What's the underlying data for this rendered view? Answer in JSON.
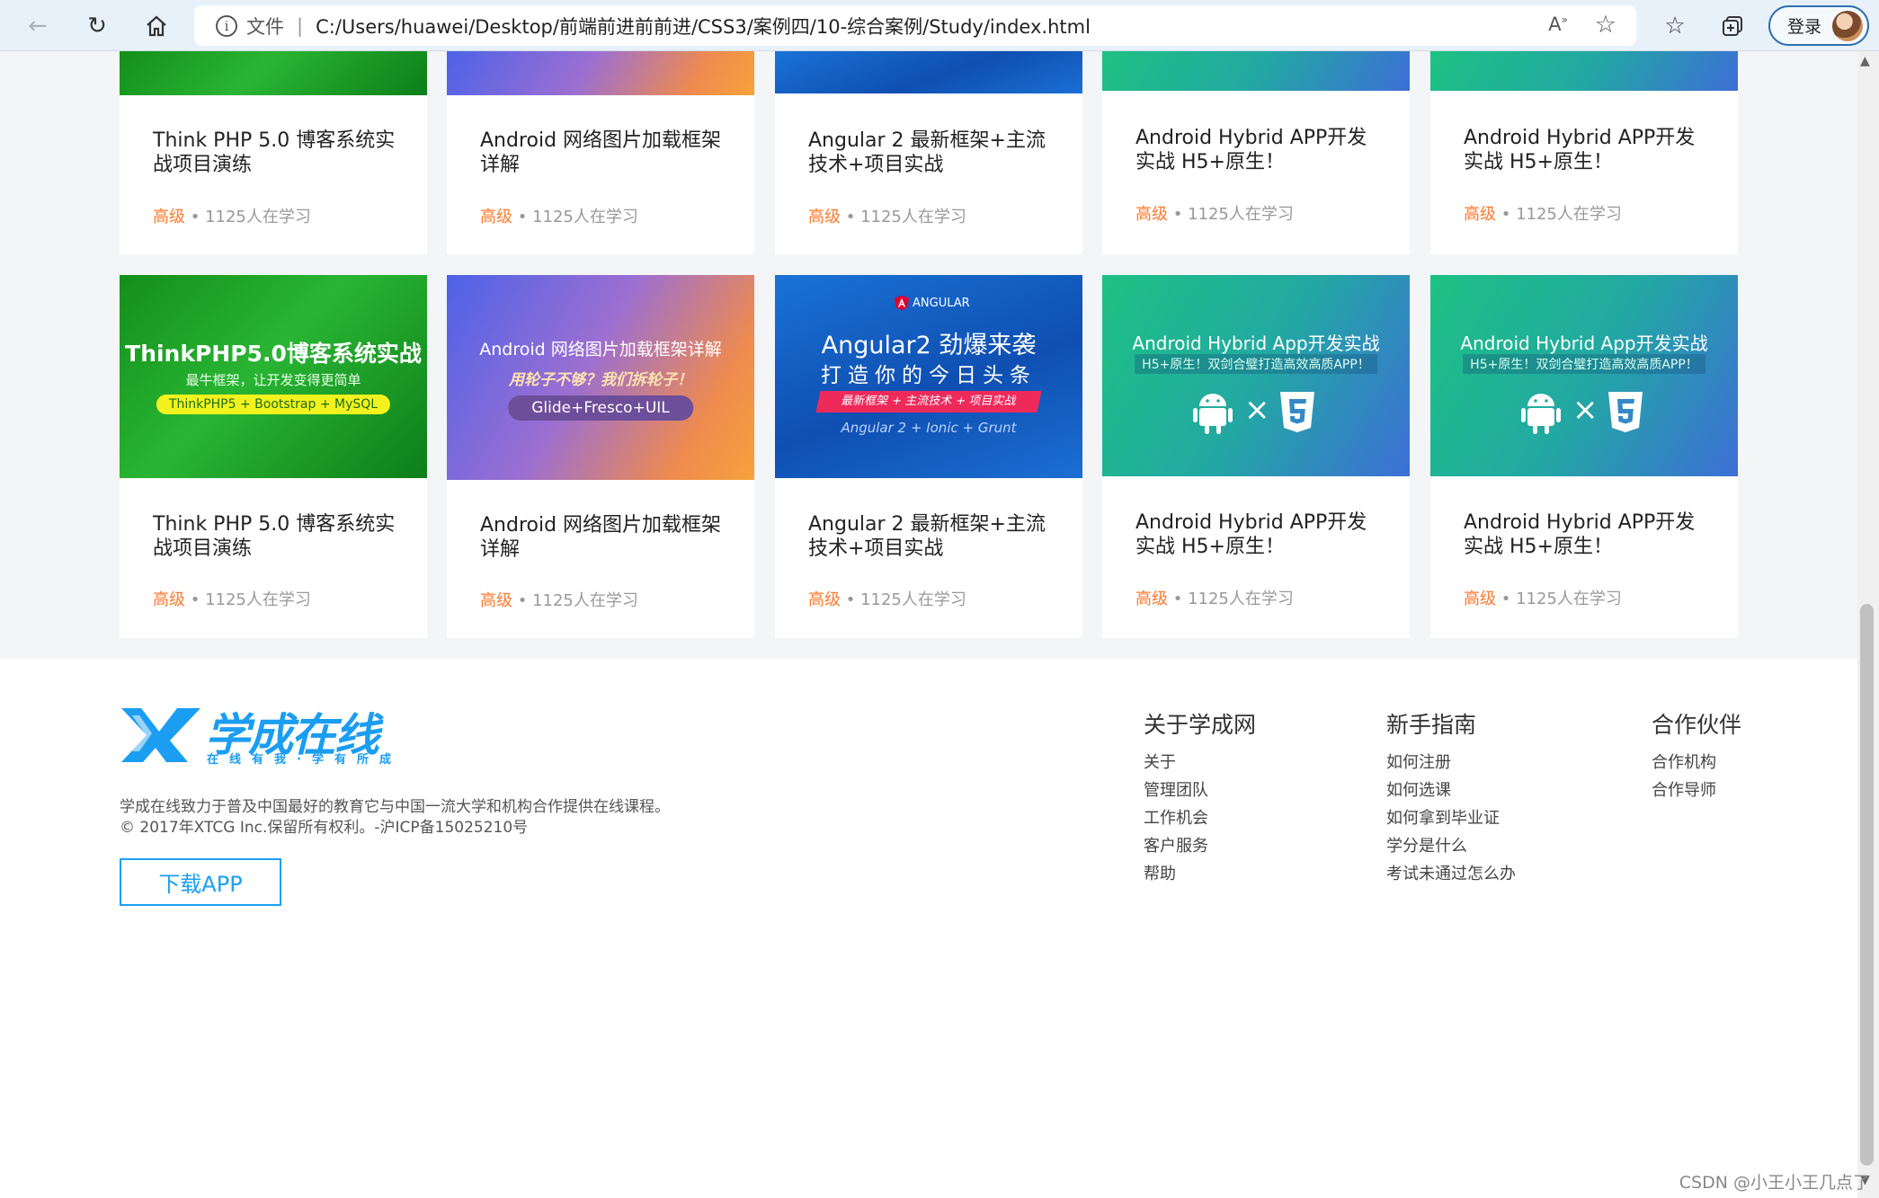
{
  "browser": {
    "scheme_label": "文件",
    "url": "C:/Users/huawei/Desktop/前端前进前前进/CSS3/案例四/10-综合案例/Study/index.html",
    "login_label": "登录"
  },
  "courses": [
    {
      "title": "Think PHP 5.0 博客系统实战项目演练",
      "level": "高级",
      "learners": "1125人在学习"
    },
    {
      "title": "Android 网络图片加载框架详解",
      "level": "高级",
      "learners": "1125人在学习"
    },
    {
      "title": "Angular 2 最新框架+主流技术+项目实战",
      "level": "高级",
      "learners": "1125人在学习"
    },
    {
      "title": "Android Hybrid APP开发实战 H5+原生！",
      "level": "高级",
      "learners": "1125人在学习"
    },
    {
      "title": "Android Hybrid APP开发实战 H5+原生！",
      "level": "高级",
      "learners": "1125人在学习"
    }
  ],
  "banners": {
    "php": {
      "title": "ThinkPHP5.0博客系统实战",
      "sub": "最牛框架，让开发变得更简单",
      "pill": "ThinkPHP5 + Bootstrap + MySQL"
    },
    "android": {
      "title": "Android 网络图片加载框架详解",
      "sub": "用轮子不够？我们拆轮子！",
      "pill": "Glide+Fresco+UIL"
    },
    "angular": {
      "brand": "ANGULAR",
      "title": "Angular2 劲爆来袭",
      "sub": "打造你的今日头条",
      "ribbon": "最新框架 + 主流技术 + 项目实战",
      "stack": "Angular 2 + Ionic + Grunt"
    },
    "hybrid": {
      "title": "Android Hybrid App开发实战",
      "sub": "H5+原生！双剑合璧打造高效高质APP！",
      "x": "×"
    }
  },
  "footer": {
    "logo_text": "学成在线",
    "logo_slogan": "在线有我·学有所成",
    "desc_line1": "学成在线致力于普及中国最好的教育它与中国一流大学和机构合作提供在线课程。",
    "desc_line2": "© 2017年XTCG Inc.保留所有权利。-沪ICP备15025210号",
    "download_label": "下载APP",
    "columns": [
      {
        "title": "关于学成网",
        "links": [
          "关于",
          "管理团队",
          "工作机会",
          "客户服务",
          "帮助"
        ]
      },
      {
        "title": "新手指南",
        "links": [
          "如何注册",
          "如何选课",
          "如何拿到毕业证",
          "学分是什么",
          "考试未通过怎么办"
        ]
      },
      {
        "title": "合作伙伴",
        "links": [
          "合作机构",
          "合作导师"
        ]
      }
    ]
  },
  "watermark": "CSDN @小王小王几点了"
}
